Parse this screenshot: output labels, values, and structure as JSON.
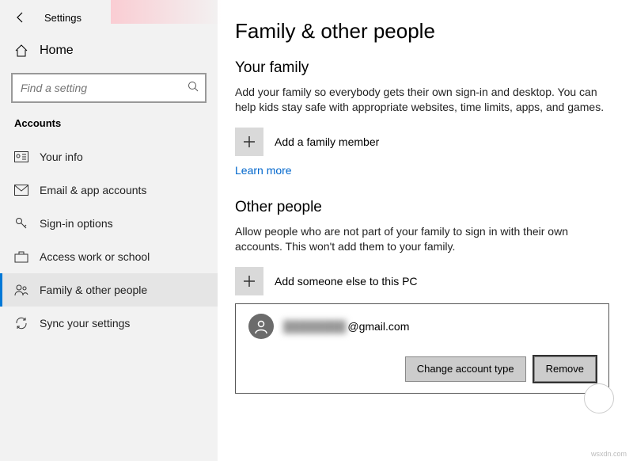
{
  "header": {
    "back": "←",
    "title": "Settings"
  },
  "home": {
    "label": "Home"
  },
  "search": {
    "placeholder": "Find a setting"
  },
  "section": "Accounts",
  "nav": [
    {
      "name": "your-info",
      "label": "Your info"
    },
    {
      "name": "email-accounts",
      "label": "Email & app accounts"
    },
    {
      "name": "sign-in-options",
      "label": "Sign-in options"
    },
    {
      "name": "access-work-school",
      "label": "Access work or school"
    },
    {
      "name": "family-other-people",
      "label": "Family & other people"
    },
    {
      "name": "sync-settings",
      "label": "Sync your settings"
    }
  ],
  "main": {
    "title": "Family & other people",
    "family": {
      "heading": "Your family",
      "desc": "Add your family so everybody gets their own sign-in and desktop. You can help kids stay safe with appropriate websites, time limits, apps, and games.",
      "add": "Add a family member",
      "learn_more": "Learn more"
    },
    "other": {
      "heading": "Other people",
      "desc": "Allow people who are not part of your family to sign in with their own accounts. This won't add them to your family.",
      "add": "Add someone else to this PC"
    },
    "user": {
      "email_redacted": "████████",
      "email_domain": "@gmail.com",
      "change": "Change account type",
      "remove": "Remove"
    }
  },
  "watermark": "wsxdn.com"
}
